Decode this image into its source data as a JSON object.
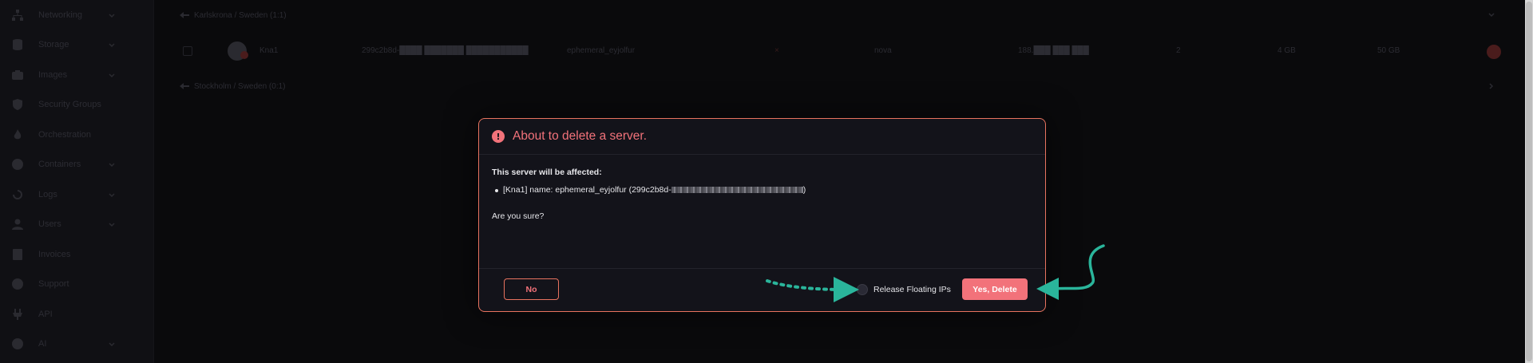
{
  "sidebar": {
    "items": [
      {
        "label": "Networking",
        "icon": "network-icon",
        "has_chevron": true
      },
      {
        "label": "Storage",
        "icon": "storage-icon",
        "has_chevron": true
      },
      {
        "label": "Images",
        "icon": "camera-icon",
        "has_chevron": true
      },
      {
        "label": "Security Groups",
        "icon": "shield-icon",
        "has_chevron": false
      },
      {
        "label": "Orchestration",
        "icon": "flame-icon",
        "has_chevron": false
      },
      {
        "label": "Containers",
        "icon": "globe-icon",
        "has_chevron": true
      },
      {
        "label": "Logs",
        "icon": "history-icon",
        "has_chevron": true
      },
      {
        "label": "Users",
        "icon": "user-icon",
        "has_chevron": true
      },
      {
        "label": "Invoices",
        "icon": "invoice-icon",
        "has_chevron": false
      },
      {
        "label": "Support",
        "icon": "support-icon",
        "has_chevron": false
      },
      {
        "label": "API",
        "icon": "plug-icon",
        "has_chevron": false
      },
      {
        "label": "AI",
        "icon": "ai-icon",
        "has_chevron": true
      }
    ]
  },
  "regions": [
    {
      "label": "Karlskrona / Sweden (1:1)"
    },
    {
      "label": "Stockholm / Sweden (0:1)"
    }
  ],
  "server_row": {
    "region": "Kna1",
    "id": "299c2b8d-████ ███████ ███████████",
    "name": "ephemeral_eyjolfur",
    "status": "×",
    "network": "nova",
    "ip": "188.███ ███ ███",
    "cpu": "2",
    "ram": "4 GB",
    "disk": "50 GB"
  },
  "modal": {
    "title": "About to delete a server.",
    "affected_title": "This server will be affected:",
    "server_item_prefix": "[Kna1] name: ephemeral_eyjolfur (299c2b8d-",
    "server_item_suffix": ")",
    "confirm_question": "Are you sure?",
    "no_label": "No",
    "release_ips_label": "Release Floating IPs",
    "yes_label": "Yes, Delete",
    "release_ips_checked": false
  },
  "colors": {
    "accent_red": "#f2727a",
    "border_orange": "#e8735f",
    "annotation_teal": "#2ab59b",
    "background": "#0a0a0c"
  }
}
